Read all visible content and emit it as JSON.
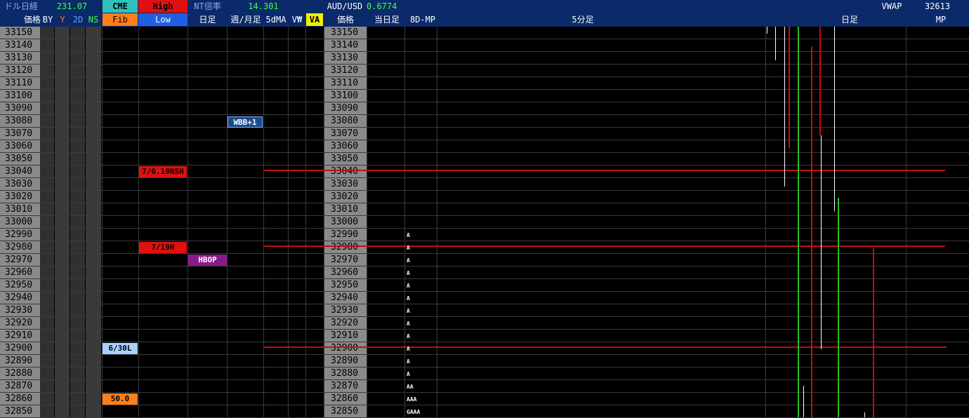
{
  "header": {
    "nikkei_dollar_label": "ドル日経",
    "nikkei_dollar_value": "231.07",
    "cme_label": "CME",
    "high_label": "High",
    "nt_label": "NT倍率",
    "nt_value": "14.301",
    "audusd_label": "AUD/USD",
    "audusd_value": "0.6774",
    "vwap_label": "VWAP",
    "vwap_value": "32613",
    "price_label": "価格",
    "by_label": "BY",
    "y_label": "Y",
    "twod_label": "2D",
    "ns_label": "NS",
    "fib_label": "Fib",
    "low_label": "Low",
    "daily_label": "日足",
    "weekly_monthly_label": "週/月足",
    "fivedma_label": "5dMA",
    "vw_label": "V₩",
    "va_label": "VA",
    "price_label2": "価格",
    "today_label": "当日足",
    "mp8d_label": "8D-MP",
    "fivemin_label": "5分足",
    "daily_label2": "日足",
    "mp_label": "MP"
  },
  "prices": [
    "33150",
    "33140",
    "33130",
    "33120",
    "33110",
    "33100",
    "33090",
    "33080",
    "33070",
    "33060",
    "33050",
    "33040",
    "33030",
    "33020",
    "33010",
    "33000",
    "32990",
    "32980",
    "32970",
    "32960",
    "32950",
    "32940",
    "32930",
    "32920",
    "32910",
    "32900",
    "32890",
    "32880",
    "32870",
    "32860",
    "32850"
  ],
  "tags": {
    "wbb": "WBB+1",
    "nsh": "7/6.19NSH",
    "h19": "7/19H",
    "hbop": "HBOP",
    "l630": "6/30L",
    "fib50": "50.0"
  },
  "mp_letters": [
    "A",
    "A",
    "A",
    "A",
    "A",
    "A",
    "A",
    "A",
    "A",
    "A",
    "A",
    "A",
    "AA",
    "AAA",
    "GAAA"
  ],
  "colors": {
    "header_bg": "#0a2a6a",
    "price_col": "#8a8a8a",
    "red": "#e01010",
    "green": "#20c020",
    "orange": "#ff7f1a",
    "purple": "#8a1a8a",
    "lightblue": "#a8d0ff",
    "yellow": "#f0f000"
  }
}
